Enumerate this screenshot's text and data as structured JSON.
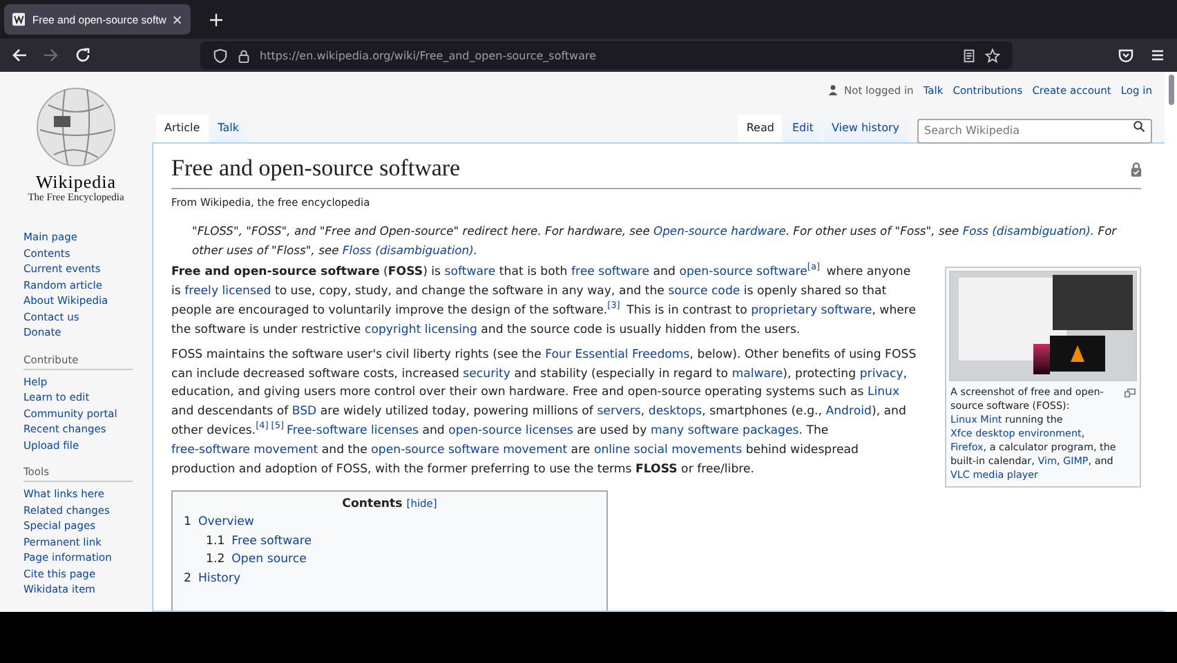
{
  "browser": {
    "tab_title": "Free and open-source softw",
    "url": "https://en.wikipedia.org/wiki/Free_and_open-source_software",
    "forward_disabled": true
  },
  "logo": {
    "wordmark": "Wikipedia",
    "tagline": "The Free Encyclopedia"
  },
  "sidebar": {
    "nav": [
      "Main page",
      "Contents",
      "Current events",
      "Random article",
      "About Wikipedia",
      "Contact us",
      "Donate"
    ],
    "sections": [
      {
        "heading": "Contribute",
        "items": [
          "Help",
          "Learn to edit",
          "Community portal",
          "Recent changes",
          "Upload file"
        ]
      },
      {
        "heading": "Tools",
        "items": [
          "What links here",
          "Related changes",
          "Special pages",
          "Permanent link",
          "Page information",
          "Cite this page",
          "Wikidata item"
        ]
      }
    ]
  },
  "user_links": {
    "status": "Not logged in",
    "links": [
      "Talk",
      "Contributions",
      "Create account",
      "Log in"
    ]
  },
  "namespace_tabs": [
    {
      "label": "Article",
      "selected": true
    },
    {
      "label": "Talk",
      "selected": false
    }
  ],
  "view_tabs": [
    {
      "label": "Read",
      "selected": true
    },
    {
      "label": "Edit",
      "selected": false
    },
    {
      "label": "View history",
      "selected": false
    }
  ],
  "search": {
    "placeholder": "Search Wikipedia"
  },
  "article": {
    "title": "Free and open-source software",
    "tagline": "From Wikipedia, the free encyclopedia",
    "hatnote": [
      {
        "kind": "plain",
        "text": "\"FLOSS\", \"FOSS\", and \"Free and Open-source\" redirect here. For hardware, see "
      },
      {
        "kind": "link",
        "text": "Open-source hardware"
      },
      {
        "kind": "plain",
        "text": ". For other uses of \"Foss\", see "
      },
      {
        "kind": "link",
        "text": "Foss (disambiguation)"
      },
      {
        "kind": "plain",
        "text": ". For other uses of \"Floss\", see "
      },
      {
        "kind": "link",
        "text": "Floss (disambiguation)"
      },
      {
        "kind": "plain",
        "text": "."
      }
    ],
    "paragraphs": [
      [
        {
          "kind": "bold",
          "text": "Free and open-source software"
        },
        {
          "kind": "plain",
          "text": " ("
        },
        {
          "kind": "bold",
          "text": "FOSS"
        },
        {
          "kind": "plain",
          "text": ") is "
        },
        {
          "kind": "link",
          "text": "software"
        },
        {
          "kind": "plain",
          "text": " that is both "
        },
        {
          "kind": "link",
          "text": "free software"
        },
        {
          "kind": "plain",
          "text": " and "
        },
        {
          "kind": "link",
          "text": "open-source software"
        },
        {
          "kind": "ref",
          "text": "[a]"
        },
        {
          "kind": "plain",
          "text": " where anyone is "
        },
        {
          "kind": "link",
          "text": "freely licensed"
        },
        {
          "kind": "plain",
          "text": " to use, copy, study, and change the software in any way, and the "
        },
        {
          "kind": "link",
          "text": "source code"
        },
        {
          "kind": "plain",
          "text": " is openly shared so that people are encouraged to voluntarily improve the design of the software."
        },
        {
          "kind": "ref",
          "text": "[3]"
        },
        {
          "kind": "plain",
          "text": " This is in contrast to "
        },
        {
          "kind": "link",
          "text": "proprietary software"
        },
        {
          "kind": "plain",
          "text": ", where the software is under restrictive "
        },
        {
          "kind": "link",
          "text": "copyright licensing"
        },
        {
          "kind": "plain",
          "text": " and the source code is usually hidden from the users."
        }
      ],
      [
        {
          "kind": "plain",
          "text": "FOSS maintains the software user's civil liberty rights (see the "
        },
        {
          "kind": "link",
          "text": "Four Essential Freedoms"
        },
        {
          "kind": "plain",
          "text": ", below). Other benefits of using FOSS can include decreased software costs, increased "
        },
        {
          "kind": "link",
          "text": "security"
        },
        {
          "kind": "plain",
          "text": " and stability (especially in regard to "
        },
        {
          "kind": "link",
          "text": "malware"
        },
        {
          "kind": "plain",
          "text": "), protecting "
        },
        {
          "kind": "link",
          "text": "privacy"
        },
        {
          "kind": "plain",
          "text": ", education, and giving users more control over their own hardware. Free and open-source operating systems such as "
        },
        {
          "kind": "link",
          "text": "Linux"
        },
        {
          "kind": "plain",
          "text": " and descendants of "
        },
        {
          "kind": "link",
          "text": "BSD"
        },
        {
          "kind": "plain",
          "text": " are widely utilized today, powering millions of "
        },
        {
          "kind": "link",
          "text": "servers"
        },
        {
          "kind": "plain",
          "text": ", "
        },
        {
          "kind": "link",
          "text": "desktops"
        },
        {
          "kind": "plain",
          "text": ", smartphones (e.g., "
        },
        {
          "kind": "link",
          "text": "Android"
        },
        {
          "kind": "plain",
          "text": "), and other devices."
        },
        {
          "kind": "ref",
          "text": "[4]"
        },
        {
          "kind": "ref",
          "text": "[5]"
        },
        {
          "kind": "link",
          "text": "Free-software licenses"
        },
        {
          "kind": "plain",
          "text": " and "
        },
        {
          "kind": "link",
          "text": "open-source licenses"
        },
        {
          "kind": "plain",
          "text": " are used by "
        },
        {
          "kind": "link",
          "text": "many software packages"
        },
        {
          "kind": "plain",
          "text": ". The "
        },
        {
          "kind": "link",
          "text": "free-software movement"
        },
        {
          "kind": "plain",
          "text": " and the "
        },
        {
          "kind": "link",
          "text": "open-source software movement"
        },
        {
          "kind": "plain",
          "text": " are "
        },
        {
          "kind": "link",
          "text": "online social movements"
        },
        {
          "kind": "plain",
          "text": " behind widespread production and adoption of FOSS, with the former preferring to use the terms "
        },
        {
          "kind": "bold",
          "text": "FLOSS"
        },
        {
          "kind": "plain",
          "text": " or free/libre."
        }
      ]
    ],
    "figure": {
      "caption": [
        {
          "kind": "plain",
          "text": "A screenshot of free and open-source software (FOSS): "
        },
        {
          "kind": "link",
          "text": "Linux Mint"
        },
        {
          "kind": "plain",
          "text": " running the "
        },
        {
          "kind": "link",
          "text": "Xfce desktop environment"
        },
        {
          "kind": "plain",
          "text": ", "
        },
        {
          "kind": "link",
          "text": "Firefox"
        },
        {
          "kind": "plain",
          "text": ", a calculator program, the built-in calendar, "
        },
        {
          "kind": "link",
          "text": "Vim"
        },
        {
          "kind": "plain",
          "text": ", "
        },
        {
          "kind": "link",
          "text": "GIMP"
        },
        {
          "kind": "plain",
          "text": ", and "
        },
        {
          "kind": "link",
          "text": "VLC media player"
        }
      ]
    },
    "toc": {
      "title": "Contents",
      "toggle": "[hide]",
      "items": [
        {
          "number": "1",
          "label": "Overview",
          "children": [
            {
              "number": "1.1",
              "label": "Free software"
            },
            {
              "number": "1.2",
              "label": "Open source"
            }
          ]
        },
        {
          "number": "2",
          "label": "History"
        }
      ]
    }
  }
}
